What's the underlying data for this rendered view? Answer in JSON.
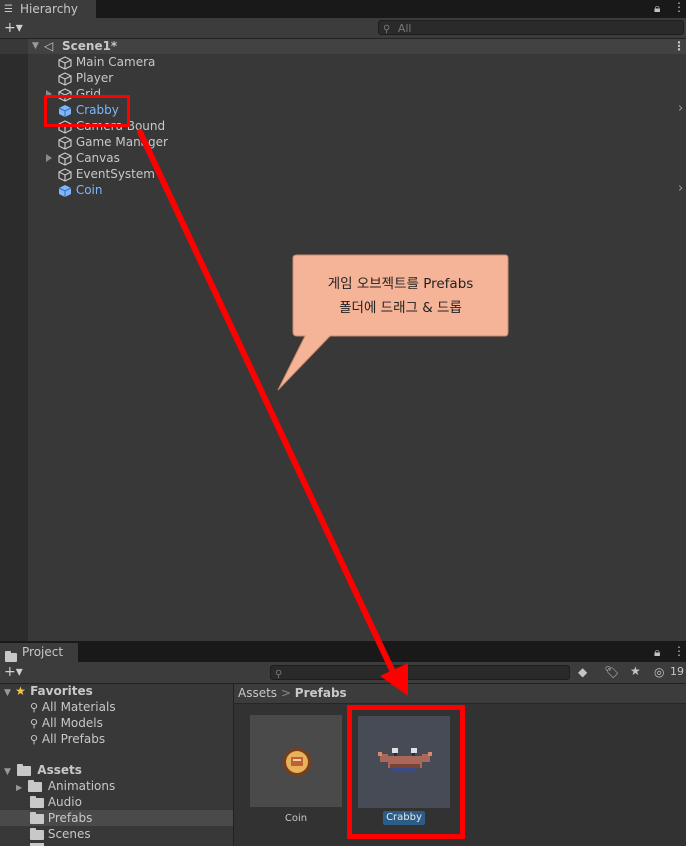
{
  "hierarchy": {
    "tab_label": "Hierarchy",
    "add_label": "+▾",
    "search_placeholder": "All",
    "scene_name": "Scene1*",
    "items": [
      {
        "label": "Main Camera"
      },
      {
        "label": "Player"
      },
      {
        "label": "Grid"
      },
      {
        "label": "Crabby"
      },
      {
        "label": "Camera Bound"
      },
      {
        "label": "Game Manager"
      },
      {
        "label": "Canvas"
      },
      {
        "label": "EventSystem"
      },
      {
        "label": "Coin"
      }
    ]
  },
  "callout": {
    "line1": "게임 오브젝트를 Prefabs",
    "line2": "폴더에 드래그 & 드롭"
  },
  "project": {
    "tab_label": "Project",
    "add_label": "+▾",
    "hidden_count": "19",
    "favorites_label": "Favorites",
    "favorites": [
      {
        "label": "All Materials"
      },
      {
        "label": "All Models"
      },
      {
        "label": "All Prefabs"
      }
    ],
    "assets_label": "Assets",
    "folders": [
      {
        "label": "Animations"
      },
      {
        "label": "Audio"
      },
      {
        "label": "Prefabs"
      },
      {
        "label": "Scenes"
      }
    ],
    "breadcrumb": {
      "root": "Assets",
      "separator": ">",
      "current": "Prefabs"
    },
    "assets": [
      {
        "label": "Coin"
      },
      {
        "label": "Crabby"
      }
    ]
  },
  "colors": {
    "annotation_red": "#ff0000",
    "prefab_blue": "#7db6ff",
    "callout_fill": "#f5b497"
  }
}
